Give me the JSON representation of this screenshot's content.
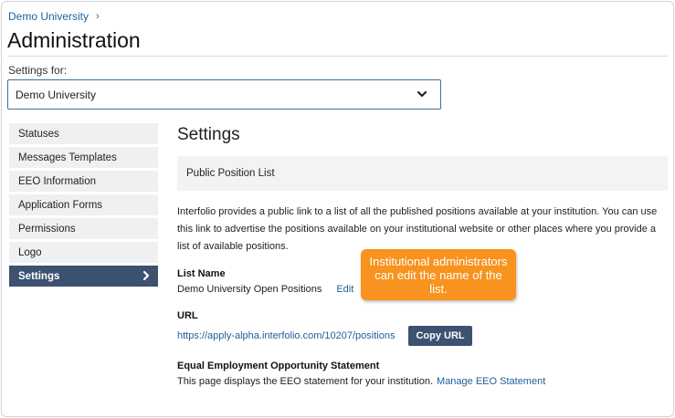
{
  "breadcrumb": {
    "item": "Demo University"
  },
  "page": {
    "title": "Administration"
  },
  "settings_for": {
    "label": "Settings for:",
    "selected": "Demo University"
  },
  "sidebar": {
    "items": [
      {
        "label": "Statuses"
      },
      {
        "label": "Messages Templates"
      },
      {
        "label": "EEO Information"
      },
      {
        "label": "Application Forms"
      },
      {
        "label": "Permissions"
      },
      {
        "label": "Logo"
      },
      {
        "label": "Settings",
        "active": true
      }
    ]
  },
  "main": {
    "title": "Settings",
    "section": "Public Position List",
    "description": "Interfolio provides a public link to a list of all the published positions available at your institution. You can use this link to advertise the positions available on your institutional website or other places where you provide a list of available positions.",
    "list_name": {
      "label": "List Name",
      "value": "Demo University Open Positions",
      "edit_label": "Edit"
    },
    "url": {
      "label": "URL",
      "value": "https://apply-alpha.interfolio.com/10207/positions",
      "copy_label": "Copy URL"
    },
    "eeo": {
      "label": "Equal Employment Opportunity Statement",
      "text": "This page displays the EEO statement for your institution.",
      "link_label": "Manage EEO Statement"
    }
  },
  "callout": {
    "text": "Institutional administrators can edit the name of the list."
  },
  "colors": {
    "link": "#1f5f99",
    "active_nav": "#3d5170",
    "callout": "#f7931e"
  }
}
